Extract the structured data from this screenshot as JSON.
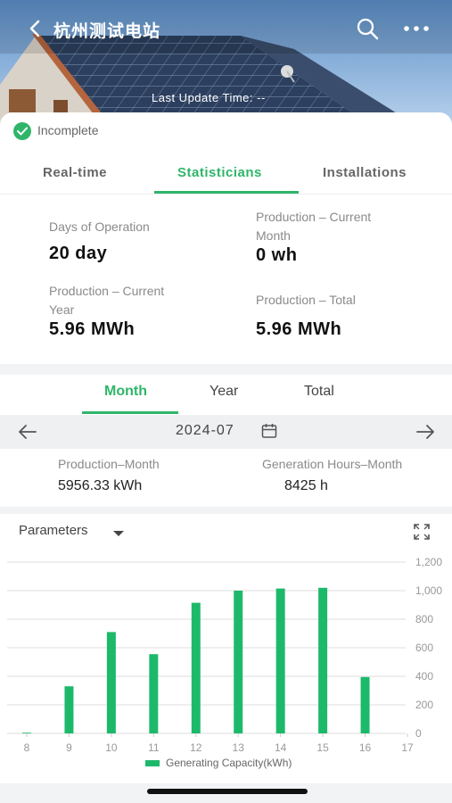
{
  "header": {
    "title": "杭州测试电站",
    "last_update": "Last Update Time: --"
  },
  "status": {
    "text": "Incomplete",
    "color": "#2fb56a"
  },
  "tabs": [
    {
      "label": "Real-time"
    },
    {
      "label": "Statisticians",
      "active": true
    },
    {
      "label": "Installations"
    }
  ],
  "stats": {
    "days_label": "Days of Operation",
    "days_value": "20 day",
    "prod_month_label_1": "Production – Current",
    "prod_month_label_2": "Month",
    "prod_month_value": "0 wh",
    "prod_year_label_1": "Production – Current",
    "prod_year_label_2": "Year",
    "prod_year_value": "5.96 MWh",
    "prod_total_label": "Production – Total",
    "prod_total_value": "5.96 MWh"
  },
  "period": {
    "tabs": [
      "Month",
      "Year",
      "Total"
    ],
    "active": "Month",
    "date": "2024-07"
  },
  "summary": {
    "prod_month_label": "Production–Month",
    "prod_month_value": "5956.33 kWh",
    "gen_hours_label": "Generation Hours–Month",
    "gen_hours_value": "8425 h"
  },
  "chart_controls": {
    "parameters_label": "Parameters"
  },
  "colors": {
    "accent": "#2fb56a",
    "bar": "#1db96b"
  },
  "chart_data": {
    "type": "bar",
    "categories": [
      "8",
      "9",
      "10",
      "11",
      "12",
      "13",
      "14",
      "15",
      "16",
      "17"
    ],
    "series": [
      {
        "name": "Generating Capacity(kWh)",
        "values": [
          5,
          330,
          710,
          555,
          915,
          1000,
          1015,
          1020,
          395,
          0
        ]
      }
    ],
    "yticks": [
      "0",
      "200",
      "400",
      "600",
      "800",
      "1,000",
      "1,200"
    ],
    "ylim": [
      0,
      1200
    ],
    "grid": true,
    "legend": "bottom"
  }
}
